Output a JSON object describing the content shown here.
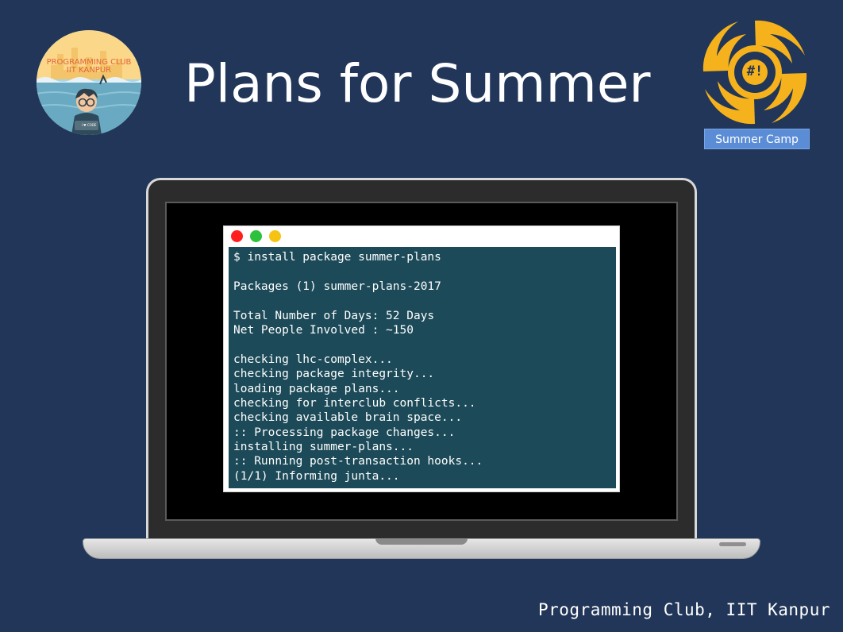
{
  "slide": {
    "title": "Plans for Summer",
    "footer": "Programming Club, IIT Kanpur",
    "background_color": "#213658"
  },
  "logo_left": {
    "line1": "PROGRAMMING CLUB",
    "line2": "IIT KANPUR",
    "shirt_text": "I ♥ CODE"
  },
  "logo_right": {
    "symbol": "#!",
    "badge": "Summer Camp",
    "accent_color": "#f5b21c"
  },
  "terminal": {
    "buttons": [
      {
        "name": "close",
        "color": "#ff1f1f"
      },
      {
        "name": "minimize",
        "color": "#2ec23c"
      },
      {
        "name": "maximize",
        "color": "#f6c312"
      }
    ],
    "lines": [
      "$ install package summer-plans",
      "",
      "Packages (1) summer-plans-2017",
      "",
      "Total Number of Days: 52 Days",
      "Net People Involved : ~150",
      "",
      "checking lhc-complex...",
      "checking package integrity...",
      "loading package plans...",
      "checking for interclub conflicts...",
      "checking available brain space...",
      ":: Processing package changes...",
      "installing summer-plans...",
      ":: Running post-transaction hooks...",
      "(1/1) Informing junta..."
    ]
  }
}
